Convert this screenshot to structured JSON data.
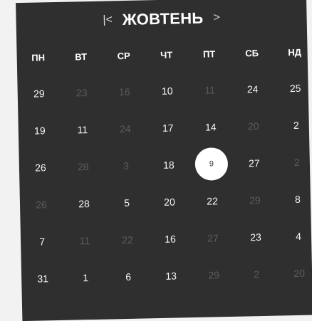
{
  "calendar": {
    "month_label": "ЖОВТЕНЬ",
    "prev_label": "|<",
    "next_label": ">",
    "weekdays": [
      "ПН",
      "ВТ",
      "СР",
      "ЧТ",
      "ПТ",
      "СБ",
      "НД"
    ],
    "rows": [
      [
        {
          "t": "29",
          "m": false
        },
        {
          "t": "23",
          "m": true
        },
        {
          "t": "16",
          "m": true
        },
        {
          "t": "10",
          "m": false
        },
        {
          "t": "11",
          "m": true
        },
        {
          "t": "24",
          "m": false
        },
        {
          "t": "25",
          "m": false
        }
      ],
      [
        {
          "t": "19",
          "m": false
        },
        {
          "t": "11",
          "m": false
        },
        {
          "t": "24",
          "m": true
        },
        {
          "t": "17",
          "m": false
        },
        {
          "t": "14",
          "m": false
        },
        {
          "t": "20",
          "m": true
        },
        {
          "t": "2",
          "m": false
        }
      ],
      [
        {
          "t": "26",
          "m": false
        },
        {
          "t": "28",
          "m": true
        },
        {
          "t": "3",
          "m": true
        },
        {
          "t": "18",
          "m": false
        },
        {
          "t": "9",
          "m": false,
          "sel": true
        },
        {
          "t": "27",
          "m": false
        },
        {
          "t": "2",
          "m": true
        }
      ],
      [
        {
          "t": "26",
          "m": true
        },
        {
          "t": "28",
          "m": false
        },
        {
          "t": "5",
          "m": false
        },
        {
          "t": "20",
          "m": false
        },
        {
          "t": "22",
          "m": false
        },
        {
          "t": "29",
          "m": true
        },
        {
          "t": "8",
          "m": false
        }
      ],
      [
        {
          "t": "7",
          "m": false
        },
        {
          "t": "11",
          "m": true
        },
        {
          "t": "22",
          "m": true
        },
        {
          "t": "16",
          "m": false
        },
        {
          "t": "27",
          "m": true
        },
        {
          "t": "23",
          "m": false
        },
        {
          "t": "4",
          "m": false
        }
      ],
      [
        {
          "t": "31",
          "m": false
        },
        {
          "t": "1",
          "m": false
        },
        {
          "t": "6",
          "m": false
        },
        {
          "t": "13",
          "m": false
        },
        {
          "t": "29",
          "m": true
        },
        {
          "t": "2",
          "m": true
        },
        {
          "t": "20",
          "m": true
        }
      ]
    ]
  },
  "colors": {
    "panel_bg": "#2f2f2f",
    "selected_bg": "#ffffff",
    "muted_text": "#5b5b5b"
  }
}
